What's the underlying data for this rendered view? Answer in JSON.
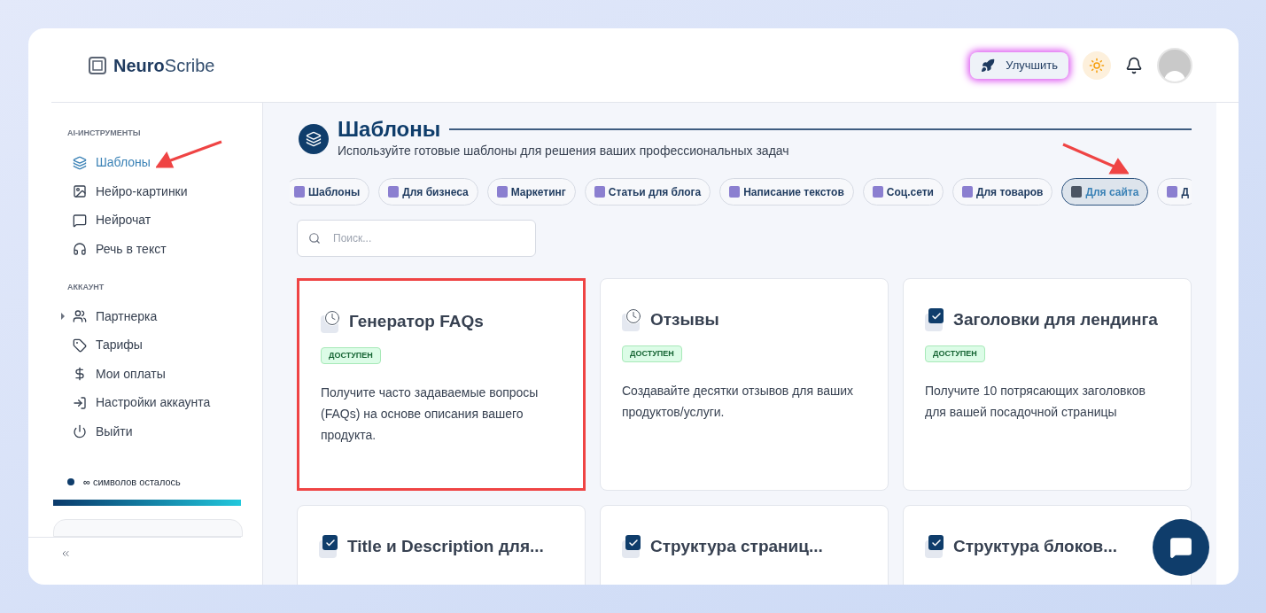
{
  "header": {
    "brand_bold": "Neuro",
    "brand_light": "Scribe",
    "upgrade_button": "Улучшить"
  },
  "sidebar": {
    "sections": [
      {
        "heading": "AI-ИНСТРУМЕНТЫ",
        "items": [
          {
            "label": "Шаблоны",
            "selected": true,
            "expandable": false,
            "annotated": true
          },
          {
            "label": "Нейро-картинки",
            "selected": false,
            "expandable": false,
            "annotated": false
          },
          {
            "label": "Нейрочат",
            "selected": false,
            "expandable": false,
            "annotated": false
          },
          {
            "label": "Речь в текст",
            "selected": false,
            "expandable": false,
            "annotated": false
          }
        ]
      },
      {
        "heading": "АККАУНТ",
        "items": [
          {
            "label": "Партнерка",
            "selected": false,
            "expandable": true,
            "annotated": false
          },
          {
            "label": "Тарифы",
            "selected": false,
            "expandable": false,
            "annotated": false
          },
          {
            "label": "Мои оплаты",
            "selected": false,
            "expandable": false,
            "annotated": false
          },
          {
            "label": "Настройки аккаунта",
            "selected": false,
            "expandable": false,
            "annotated": false
          },
          {
            "label": "Выйти",
            "selected": false,
            "expandable": false,
            "annotated": false
          }
        ]
      }
    ],
    "usage": {
      "amount": "∞",
      "label": "символов осталось",
      "level": 1
    }
  },
  "page": {
    "title": "Шаблоны",
    "subtitle": "Используйте готовые шаблоны для решения ваших профессиональных задач",
    "categories": [
      {
        "label": "Шаблоны",
        "selected": false,
        "annotated": false
      },
      {
        "label": "Для бизнеса",
        "selected": false,
        "annotated": false
      },
      {
        "label": "Маркетинг",
        "selected": false,
        "annotated": false
      },
      {
        "label": "Статьи для блога",
        "selected": false,
        "annotated": false
      },
      {
        "label": "Написание текстов",
        "selected": false,
        "annotated": false
      },
      {
        "label": "Соц.сети",
        "selected": false,
        "annotated": false
      },
      {
        "label": "Для товаров",
        "selected": false,
        "annotated": false
      },
      {
        "label": "Для сайта",
        "selected": true,
        "annotated": true
      },
      {
        "label": "Д",
        "selected": false,
        "annotated": false
      }
    ],
    "search": {
      "placeholder": "Поиск..."
    },
    "cards": [
      {
        "kind": "clock",
        "title": "Генератор FAQs",
        "badge": "ДОСТУПЕН",
        "description": "Получите часто задаваемые вопросы (FAQs) на основе описания вашего продукта.",
        "highlighted": true
      },
      {
        "kind": "clock",
        "title": "Отзывы",
        "badge": "ДОСТУПЕН",
        "description": "Создавайте десятки отзывов для ваших продуктов/услуги.",
        "highlighted": false
      },
      {
        "kind": "check",
        "title": "Заголовки для лендинга",
        "badge": "ДОСТУПЕН",
        "description": "Получите 10 потрясающих заголовков для вашей посадочной страницы",
        "highlighted": false
      },
      {
        "kind": "check",
        "title": "Title и Description для...",
        "highlighted": false
      },
      {
        "kind": "check",
        "title": "Структура страниц...",
        "highlighted": false
      },
      {
        "kind": "check",
        "title": "Структура блоков...",
        "highlighted": false
      }
    ]
  }
}
